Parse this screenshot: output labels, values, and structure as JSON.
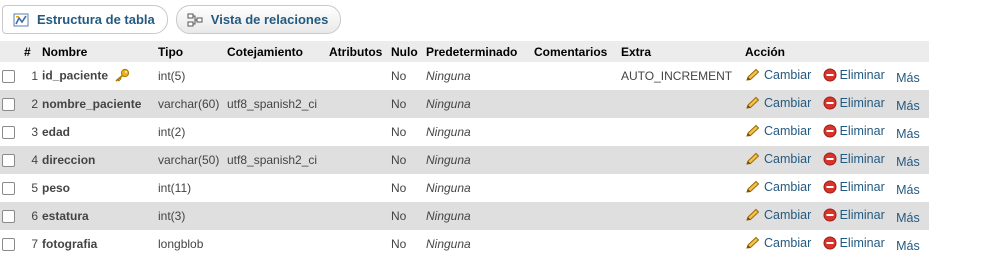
{
  "tabs": [
    {
      "label": "Estructura de tabla",
      "icon": "table-structure-icon"
    },
    {
      "label": "Vista de relaciones",
      "icon": "relations-icon"
    }
  ],
  "columns": {
    "num": "#",
    "name": "Nombre",
    "type": "Tipo",
    "collation": "Cotejamiento",
    "attributes": "Atributos",
    "null": "Nulo",
    "default": "Predeterminado",
    "comments": "Comentarios",
    "extra": "Extra",
    "action": "Acción"
  },
  "actions": {
    "change": "Cambiar",
    "delete": "Eliminar",
    "more": "Más"
  },
  "colors": {
    "link": "#235a81",
    "row_alt": "#dfdfdf",
    "header": "#ececec"
  },
  "rows": [
    {
      "num": "1",
      "name": "id_paciente",
      "primary_key": true,
      "type": "int(5)",
      "collation": "",
      "attributes": "",
      "null": "No",
      "default": "Ninguna",
      "comments": "",
      "extra": "AUTO_INCREMENT"
    },
    {
      "num": "2",
      "name": "nombre_paciente",
      "primary_key": false,
      "type": "varchar(60)",
      "collation": "utf8_spanish2_ci",
      "attributes": "",
      "null": "No",
      "default": "Ninguna",
      "comments": "",
      "extra": ""
    },
    {
      "num": "3",
      "name": "edad",
      "primary_key": false,
      "type": "int(2)",
      "collation": "",
      "attributes": "",
      "null": "No",
      "default": "Ninguna",
      "comments": "",
      "extra": ""
    },
    {
      "num": "4",
      "name": "direccion",
      "primary_key": false,
      "type": "varchar(50)",
      "collation": "utf8_spanish2_ci",
      "attributes": "",
      "null": "No",
      "default": "Ninguna",
      "comments": "",
      "extra": ""
    },
    {
      "num": "5",
      "name": "peso",
      "primary_key": false,
      "type": "int(11)",
      "collation": "",
      "attributes": "",
      "null": "No",
      "default": "Ninguna",
      "comments": "",
      "extra": ""
    },
    {
      "num": "6",
      "name": "estatura",
      "primary_key": false,
      "type": "int(3)",
      "collation": "",
      "attributes": "",
      "null": "No",
      "default": "Ninguna",
      "comments": "",
      "extra": ""
    },
    {
      "num": "7",
      "name": "fotografia",
      "primary_key": false,
      "type": "longblob",
      "collation": "",
      "attributes": "",
      "null": "No",
      "default": "Ninguna",
      "comments": "",
      "extra": ""
    }
  ]
}
